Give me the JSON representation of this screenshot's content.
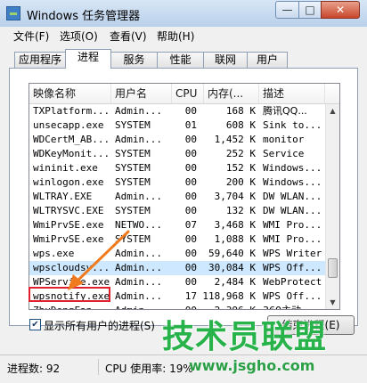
{
  "window": {
    "title": "Windows 任务管理器",
    "controls": {
      "minimize": "—",
      "maximize": "□",
      "close": "✕"
    }
  },
  "menu": [
    "文件(F)",
    "选项(O)",
    "查看(V)",
    "帮助(H)"
  ],
  "tabs": [
    "应用程序",
    "进程",
    "服务",
    "性能",
    "联网",
    "用户"
  ],
  "active_tab": "进程",
  "table": {
    "headers": [
      "映像名称",
      "用户名",
      "CPU",
      "内存(...",
      "描述"
    ],
    "rows": [
      [
        "TXPlatform...",
        "Admin...",
        "00",
        "168 K",
        "腾讯QQ..."
      ],
      [
        "unsecapp.exe",
        "SYSTEM",
        "01",
        "608 K",
        "Sink to..."
      ],
      [
        "WDCertM_AB...",
        "Admin...",
        "00",
        "1,452 K",
        "monitor"
      ],
      [
        "WDKeyMonit...",
        "SYSTEM",
        "00",
        "252 K",
        "Service"
      ],
      [
        "wininit.exe",
        "SYSTEM",
        "00",
        "152 K",
        "Windows..."
      ],
      [
        "winlogon.exe",
        "SYSTEM",
        "00",
        "200 K",
        "Windows..."
      ],
      [
        "WLTRAY.EXE",
        "Admin...",
        "00",
        "3,704 K",
        "DW WLAN..."
      ],
      [
        "WLTRYSVC.EXE",
        "SYSTEM",
        "00",
        "132 K",
        "DW WLAN..."
      ],
      [
        "WmiPrvSE.exe",
        "NETWO...",
        "07",
        "3,468 K",
        "WMI Pro..."
      ],
      [
        "WmiPrvSE.exe",
        "SYSTEM",
        "00",
        "1,088 K",
        "WMI Pro..."
      ],
      [
        "wps.exe",
        "Admin...",
        "00",
        "59,640 K",
        "WPS Writer"
      ],
      [
        "wpscloudsv...",
        "Admin...",
        "00",
        "30,084 K",
        "WPS Off..."
      ],
      [
        "WPService.exe",
        "Admin...",
        "00",
        "2,484 K",
        "WebProtect"
      ],
      [
        "wpsnotify.exe",
        "Admin...",
        "17",
        "118,968 K",
        "WPS Off..."
      ],
      [
        "ZhuDongFan...",
        "Admin...",
        "00",
        "2,396 K",
        "360主动..."
      ]
    ],
    "highlighted_row_index": 13,
    "selected_row_index": 11
  },
  "show_all_users": {
    "label": "显示所有用户的进程(S)",
    "checked": true
  },
  "end_process_button": "结束进程(E)",
  "status": {
    "process_count": "进程数: 92",
    "cpu_usage": "CPU 使用率: 19%"
  },
  "watermark": {
    "text": "技术员联盟",
    "url": "www.jsgho.com"
  },
  "colors": {
    "highlight_border": "#e0202c",
    "arrow": "#f07a1e",
    "watermark": "#28b34a"
  }
}
